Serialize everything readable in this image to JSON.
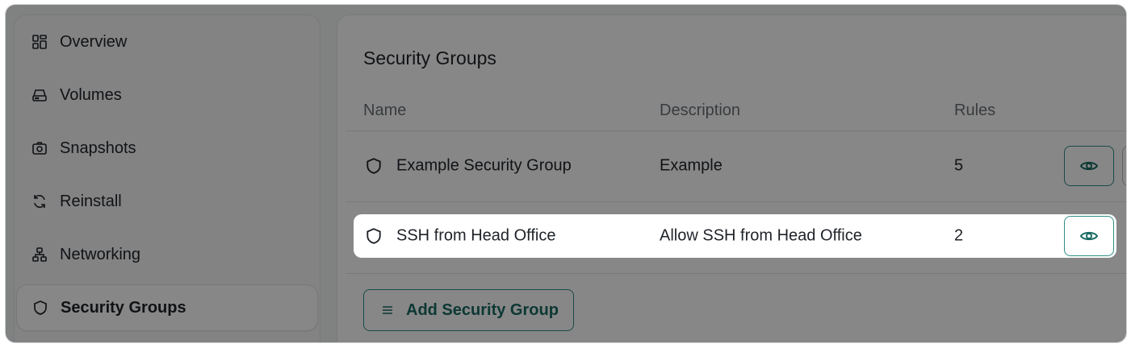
{
  "sidebar": {
    "items": [
      {
        "label": "Overview",
        "icon": "grid-icon"
      },
      {
        "label": "Volumes",
        "icon": "drive-icon"
      },
      {
        "label": "Snapshots",
        "icon": "camera-icon"
      },
      {
        "label": "Reinstall",
        "icon": "refresh-icon"
      },
      {
        "label": "Networking",
        "icon": "network-icon"
      },
      {
        "label": "Security Groups",
        "icon": "shield-icon",
        "active": true
      }
    ]
  },
  "panel": {
    "title": "Security Groups",
    "columns": {
      "name": "Name",
      "description": "Description",
      "rules": "Rules"
    },
    "rows": [
      {
        "name": "Example Security Group",
        "description": "Example",
        "rules": "5"
      },
      {
        "name": "SSH from Head Office",
        "description": "Allow SSH from Head Office",
        "rules": "2"
      }
    ],
    "add_button": "Add Security Group"
  },
  "colors": {
    "accent": "#2f8f86",
    "accent_text": "#1a6b63",
    "overlay": "rgba(0,0,0,0.47)"
  }
}
